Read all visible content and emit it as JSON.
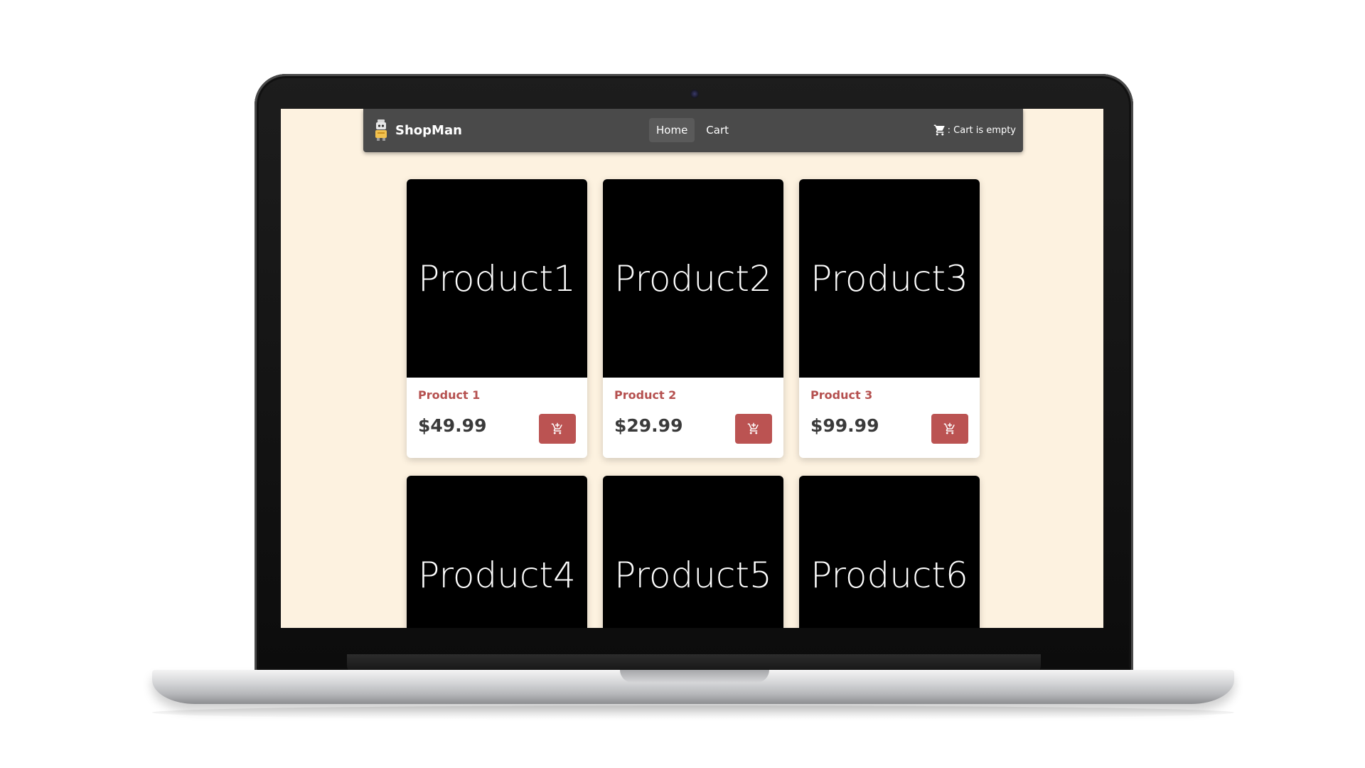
{
  "app": {
    "brand_name": "ShopMan",
    "brand_logo_icon": "robot-logo-icon"
  },
  "nav": {
    "links": [
      {
        "label": "Home",
        "active": true
      },
      {
        "label": "Cart",
        "active": false
      }
    ]
  },
  "cart_status": {
    "icon": "shopping-cart-icon",
    "text": ": Cart is empty"
  },
  "colors": {
    "navbar": "#4a4a4a",
    "page_background": "#fdf2e0",
    "accent": "#bb5352",
    "product_title": "#b5504f",
    "price": "#3a3a3a"
  },
  "products": [
    {
      "image_text": "Product1",
      "title": "Product 1",
      "price": "$49.99",
      "button_icon": "add-to-cart-icon"
    },
    {
      "image_text": "Product2",
      "title": "Product 2",
      "price": "$29.99",
      "button_icon": "add-to-cart-icon"
    },
    {
      "image_text": "Product3",
      "title": "Product 3",
      "price": "$99.99",
      "button_icon": "add-to-cart-icon"
    },
    {
      "image_text": "Product4",
      "title": "",
      "price": "",
      "button_icon": "add-to-cart-icon"
    },
    {
      "image_text": "Product5",
      "title": "",
      "price": "",
      "button_icon": "add-to-cart-icon"
    },
    {
      "image_text": "Product6",
      "title": "",
      "price": "",
      "button_icon": "add-to-cart-icon"
    }
  ]
}
